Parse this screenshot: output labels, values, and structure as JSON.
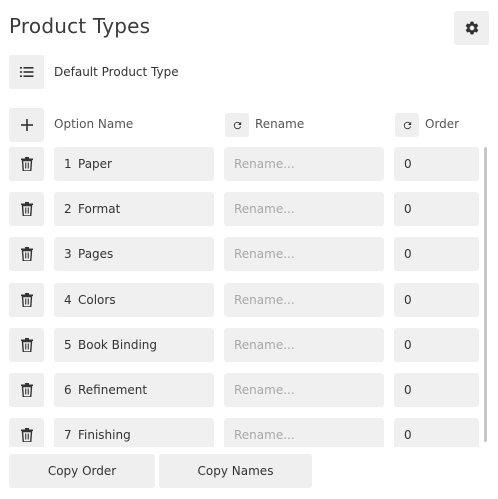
{
  "header": {
    "title": "Product Types",
    "settings_icon": "gear-icon"
  },
  "product_type": {
    "icon": "list-icon",
    "name": "Default Product Type"
  },
  "table": {
    "add_icon": "plus-icon",
    "columns": {
      "option_name": "Option Name",
      "rename": "Rename",
      "order": "Order"
    },
    "reset_icon": "refresh-icon",
    "rename_placeholder": "Rename...",
    "rows": [
      {
        "num": "1",
        "name": "Paper",
        "order": "0"
      },
      {
        "num": "2",
        "name": "Format",
        "order": "0"
      },
      {
        "num": "3",
        "name": "Pages",
        "order": "0"
      },
      {
        "num": "4",
        "name": "Colors",
        "order": "0"
      },
      {
        "num": "5",
        "name": "Book Binding",
        "order": "0"
      },
      {
        "num": "6",
        "name": "Refinement",
        "order": "0"
      },
      {
        "num": "7",
        "name": "Finishing",
        "order": "0"
      }
    ],
    "delete_icon": "trash-icon"
  },
  "footer": {
    "copy_order": "Copy Order",
    "copy_names": "Copy Names"
  }
}
